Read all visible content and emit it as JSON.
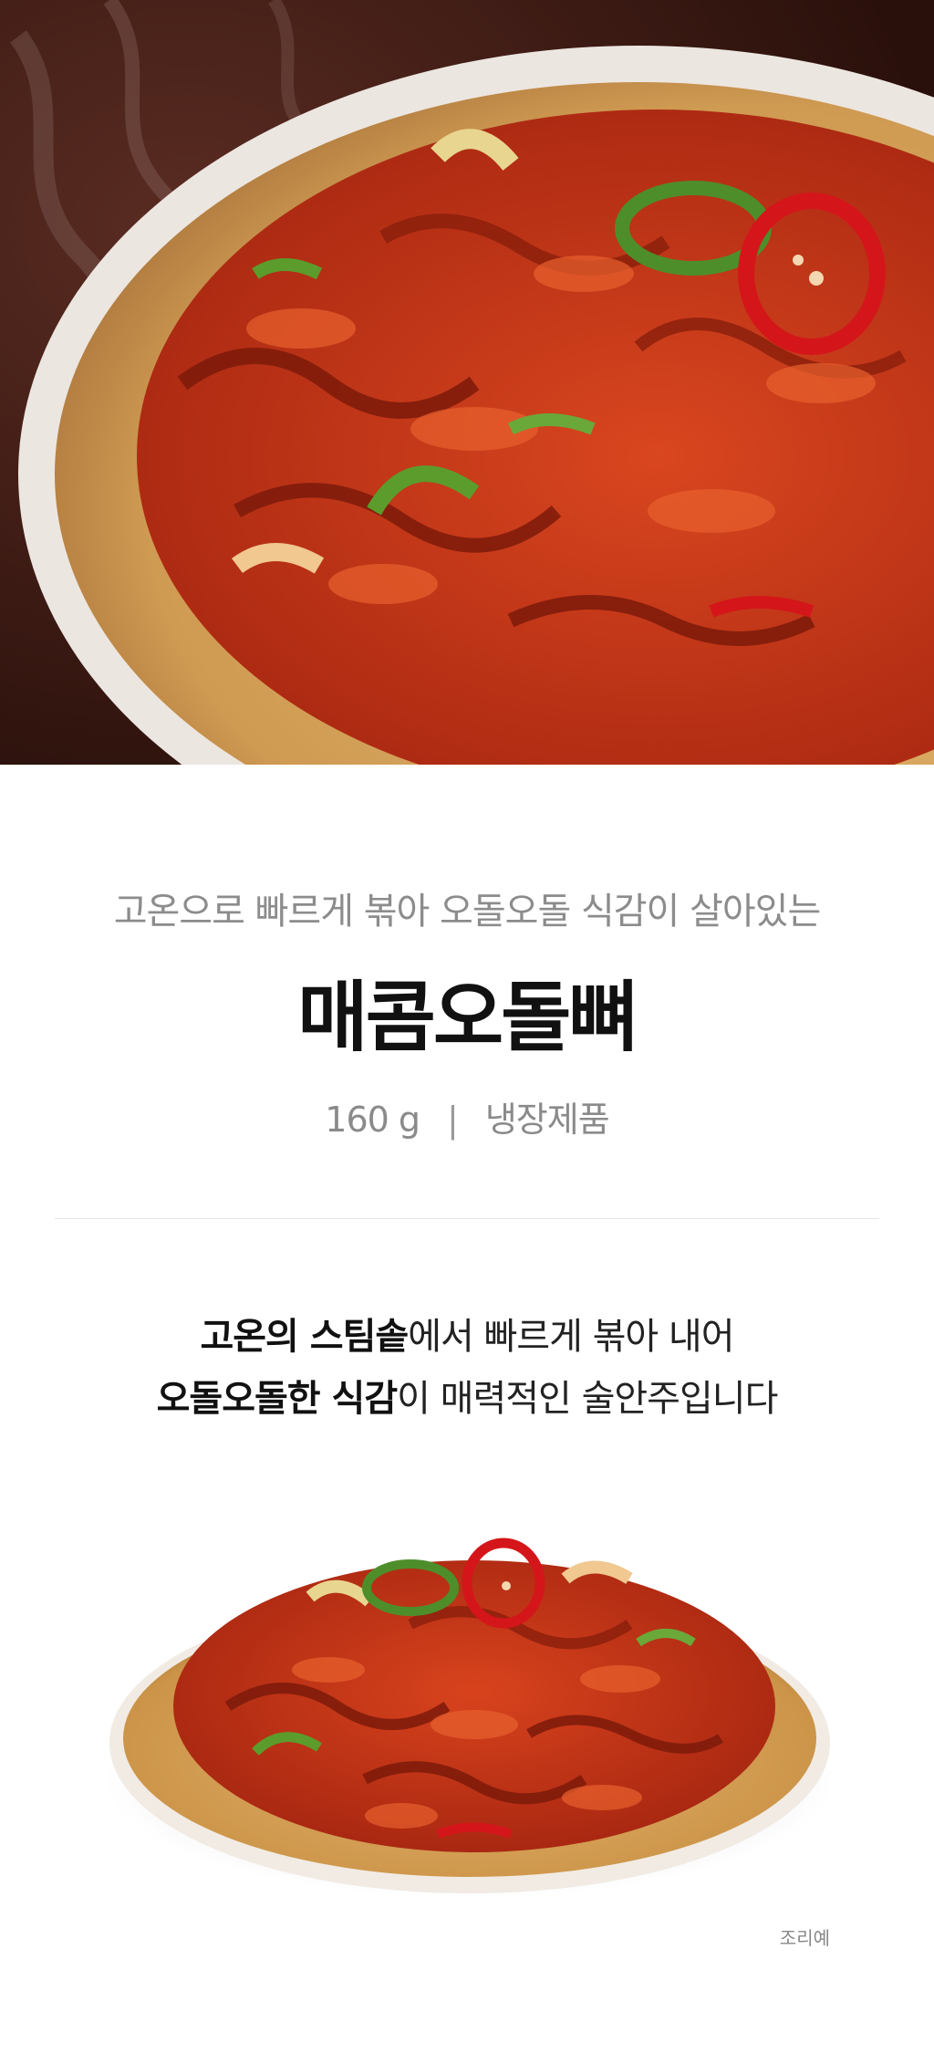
{
  "hero": {
    "image_name": "spicy-chicken-cartilage-hero-photo"
  },
  "intro": {
    "subtitle": "고온으로 빠르게 볶아 오돌오돌 식감이 살아있는",
    "title": "매콤오돌뼈",
    "weight": "160 g",
    "separator": "|",
    "storage": "냉장제품"
  },
  "description": {
    "line1_bold": "고온의 스팀솥",
    "line1_rest": "에서 빠르게 볶아 내어",
    "line2_bold": "오돌오돌한 식감",
    "line2_rest": "이 매력적인 술안주입니다"
  },
  "serving_photo": {
    "image_name": "plated-dish-photo",
    "caption": "조리예"
  },
  "colors": {
    "background_dark": "#3a1812",
    "sauce_red": "#c83a1c",
    "plate_wood": "#d9a860",
    "green_pepper": "#4e8e2a",
    "red_pepper": "#d4161a"
  }
}
